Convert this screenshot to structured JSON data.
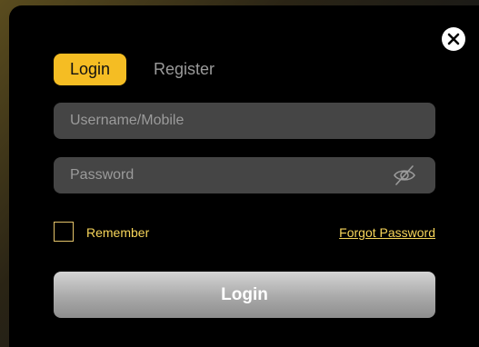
{
  "tabs": {
    "login_label": "Login",
    "register_label": "Register",
    "active": "Login"
  },
  "form": {
    "username_placeholder": "Username/Mobile",
    "username_value": "",
    "password_placeholder": "Password",
    "password_value": "",
    "remember_label": "Remember",
    "remember_checked": false,
    "forgot_label": "Forgot Password",
    "submit_label": "Login"
  },
  "icons": {
    "close": "close-icon",
    "password_visibility": "eye-off-icon"
  },
  "colors": {
    "accent": "#f5bd23",
    "link": "#f7d55a",
    "modal_bg": "#000000",
    "input_bg": "#454545"
  }
}
